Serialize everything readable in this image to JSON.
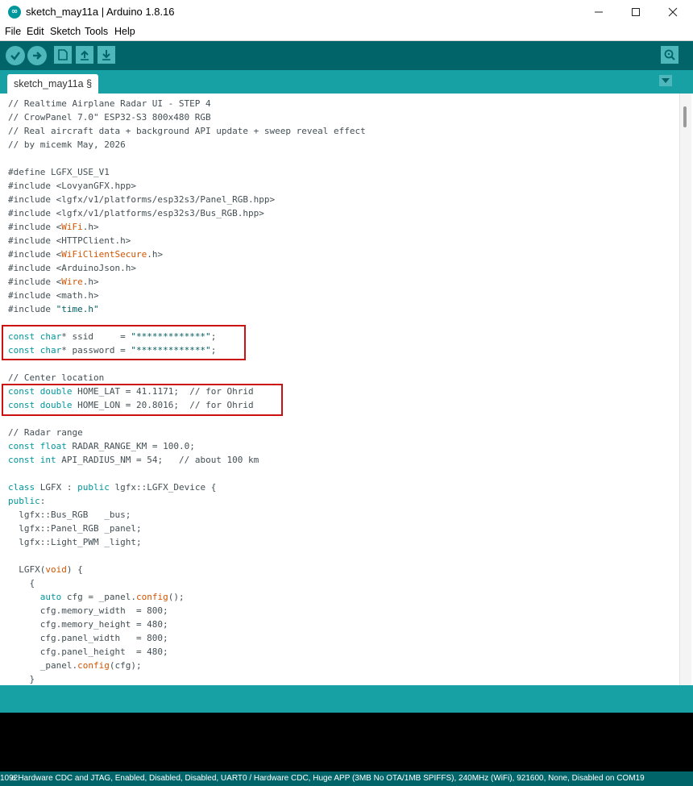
{
  "window": {
    "title": "sketch_may11a | Arduino 1.8.16",
    "app_icon": "arduino-logo-icon",
    "controls": [
      "minimize-icon",
      "maximize-icon",
      "close-icon"
    ]
  },
  "menu": {
    "items": [
      "File",
      "Edit",
      "Sketch",
      "Tools",
      "Help"
    ]
  },
  "toolbar": {
    "buttons": [
      "verify-icon",
      "upload-icon",
      "new-icon",
      "open-icon",
      "save-icon"
    ],
    "serial_monitor": "serial-monitor-icon"
  },
  "tabs": {
    "active": "sketch_may11a §",
    "menu_icon": "tab-menu-arrow-icon"
  },
  "colors": {
    "toolbar": "#006468",
    "tabbar": "#17a1a5",
    "button": "#4db7bb",
    "keyword": "#00979c",
    "library": "#d35400",
    "highlight_border": "#cc1111"
  },
  "code": {
    "lines": [
      [
        {
          "t": "// Realtime Airplane Radar UI - STEP 4",
          "c": "cm"
        }
      ],
      [
        {
          "t": "// CrowPanel 7.0\" ESP32-S3 800x480 RGB",
          "c": "cm"
        }
      ],
      [
        {
          "t": "// Real aircraft data + background API update + sweep reveal effect",
          "c": "cm"
        }
      ],
      [
        {
          "t": "// by micemk May, 2026",
          "c": "cm"
        }
      ],
      [],
      [
        {
          "t": "#define LGFX_USE_V1",
          "c": ""
        }
      ],
      [
        {
          "t": "#include <LovyanGFX.hpp>",
          "c": ""
        }
      ],
      [
        {
          "t": "#include <lgfx/v1/platforms/esp32s3/Panel_RGB.hpp>",
          "c": ""
        }
      ],
      [
        {
          "t": "#include <lgfx/v1/platforms/esp32s3/Bus_RGB.hpp>",
          "c": ""
        }
      ],
      [
        {
          "t": "#include <",
          "c": ""
        },
        {
          "t": "WiFi",
          "c": "lb"
        },
        {
          "t": ".h>",
          "c": ""
        }
      ],
      [
        {
          "t": "#include <HTTPClient.h>",
          "c": ""
        }
      ],
      [
        {
          "t": "#include <",
          "c": ""
        },
        {
          "t": "WiFiClientSecure",
          "c": "lb"
        },
        {
          "t": ".h>",
          "c": ""
        }
      ],
      [
        {
          "t": "#include <ArduinoJson.h>",
          "c": ""
        }
      ],
      [
        {
          "t": "#include <",
          "c": ""
        },
        {
          "t": "Wire",
          "c": "lb"
        },
        {
          "t": ".h>",
          "c": ""
        }
      ],
      [
        {
          "t": "#include <math.h>",
          "c": ""
        }
      ],
      [
        {
          "t": "#include ",
          "c": ""
        },
        {
          "t": "\"time.h\"",
          "c": "str"
        }
      ],
      [],
      [
        {
          "t": "const",
          "c": "kw"
        },
        {
          "t": " ",
          "c": ""
        },
        {
          "t": "char",
          "c": "kw"
        },
        {
          "t": "* ssid     = ",
          "c": ""
        },
        {
          "t": "\"*************\"",
          "c": "str"
        },
        {
          "t": ";",
          "c": ""
        }
      ],
      [
        {
          "t": "const",
          "c": "kw"
        },
        {
          "t": " ",
          "c": ""
        },
        {
          "t": "char",
          "c": "kw"
        },
        {
          "t": "* password = ",
          "c": ""
        },
        {
          "t": "\"*************\"",
          "c": "str"
        },
        {
          "t": ";",
          "c": ""
        }
      ],
      [],
      [
        {
          "t": "// Center location",
          "c": "cm"
        }
      ],
      [
        {
          "t": "const",
          "c": "kw"
        },
        {
          "t": " ",
          "c": ""
        },
        {
          "t": "double",
          "c": "kw"
        },
        {
          "t": " HOME_LAT = 41.1171;  ",
          "c": ""
        },
        {
          "t": "// for Ohrid",
          "c": "cm"
        }
      ],
      [
        {
          "t": "const",
          "c": "kw"
        },
        {
          "t": " ",
          "c": ""
        },
        {
          "t": "double",
          "c": "kw"
        },
        {
          "t": " HOME_LON = 20.8016;  ",
          "c": ""
        },
        {
          "t": "// for Ohrid",
          "c": "cm"
        }
      ],
      [],
      [
        {
          "t": "// Radar range",
          "c": "cm"
        }
      ],
      [
        {
          "t": "const",
          "c": "kw"
        },
        {
          "t": " ",
          "c": ""
        },
        {
          "t": "float",
          "c": "kw"
        },
        {
          "t": " RADAR_RANGE_KM = 100.0;",
          "c": ""
        }
      ],
      [
        {
          "t": "const",
          "c": "kw"
        },
        {
          "t": " ",
          "c": ""
        },
        {
          "t": "int",
          "c": "kw"
        },
        {
          "t": " API_RADIUS_NM = 54;   ",
          "c": ""
        },
        {
          "t": "// about 100 km",
          "c": "cm"
        }
      ],
      [],
      [
        {
          "t": "class",
          "c": "kw"
        },
        {
          "t": " LGFX : ",
          "c": ""
        },
        {
          "t": "public",
          "c": "kw"
        },
        {
          "t": " lgfx::LGFX_Device {",
          "c": ""
        }
      ],
      [
        {
          "t": "public",
          "c": "kw"
        },
        {
          "t": ":",
          "c": ""
        }
      ],
      [
        {
          "t": "  lgfx::Bus_RGB   _bus;",
          "c": ""
        }
      ],
      [
        {
          "t": "  lgfx::Panel_RGB _panel;",
          "c": ""
        }
      ],
      [
        {
          "t": "  lgfx::Light_PWM _light;",
          "c": ""
        }
      ],
      [],
      [
        {
          "t": "  LGFX(",
          "c": ""
        },
        {
          "t": "void",
          "c": "lb"
        },
        {
          "t": ") {",
          "c": ""
        }
      ],
      [
        {
          "t": "    {",
          "c": ""
        }
      ],
      [
        {
          "t": "      ",
          "c": ""
        },
        {
          "t": "auto",
          "c": "kw"
        },
        {
          "t": " cfg = _panel.",
          "c": ""
        },
        {
          "t": "config",
          "c": "lb"
        },
        {
          "t": "();",
          "c": ""
        }
      ],
      [
        {
          "t": "      cfg.memory_width  = 800;",
          "c": ""
        }
      ],
      [
        {
          "t": "      cfg.memory_height = 480;",
          "c": ""
        }
      ],
      [
        {
          "t": "      cfg.panel_width   = 800;",
          "c": ""
        }
      ],
      [
        {
          "t": "      cfg.panel_height  = 480;",
          "c": ""
        }
      ],
      [
        {
          "t": "      _panel.",
          "c": ""
        },
        {
          "t": "config",
          "c": "lb"
        },
        {
          "t": "(cfg);",
          "c": ""
        }
      ],
      [
        {
          "t": "    }",
          "c": ""
        }
      ]
    ]
  },
  "status": {
    "line_number": "1092",
    "board_info": "e Hardware CDC and JTAG, Enabled, Disabled, Disabled, UART0 / Hardware CDC, Huge APP (3MB No OTA/1MB SPIFFS), 240MHz (WiFi), 921600, None, Disabled on COM19"
  }
}
